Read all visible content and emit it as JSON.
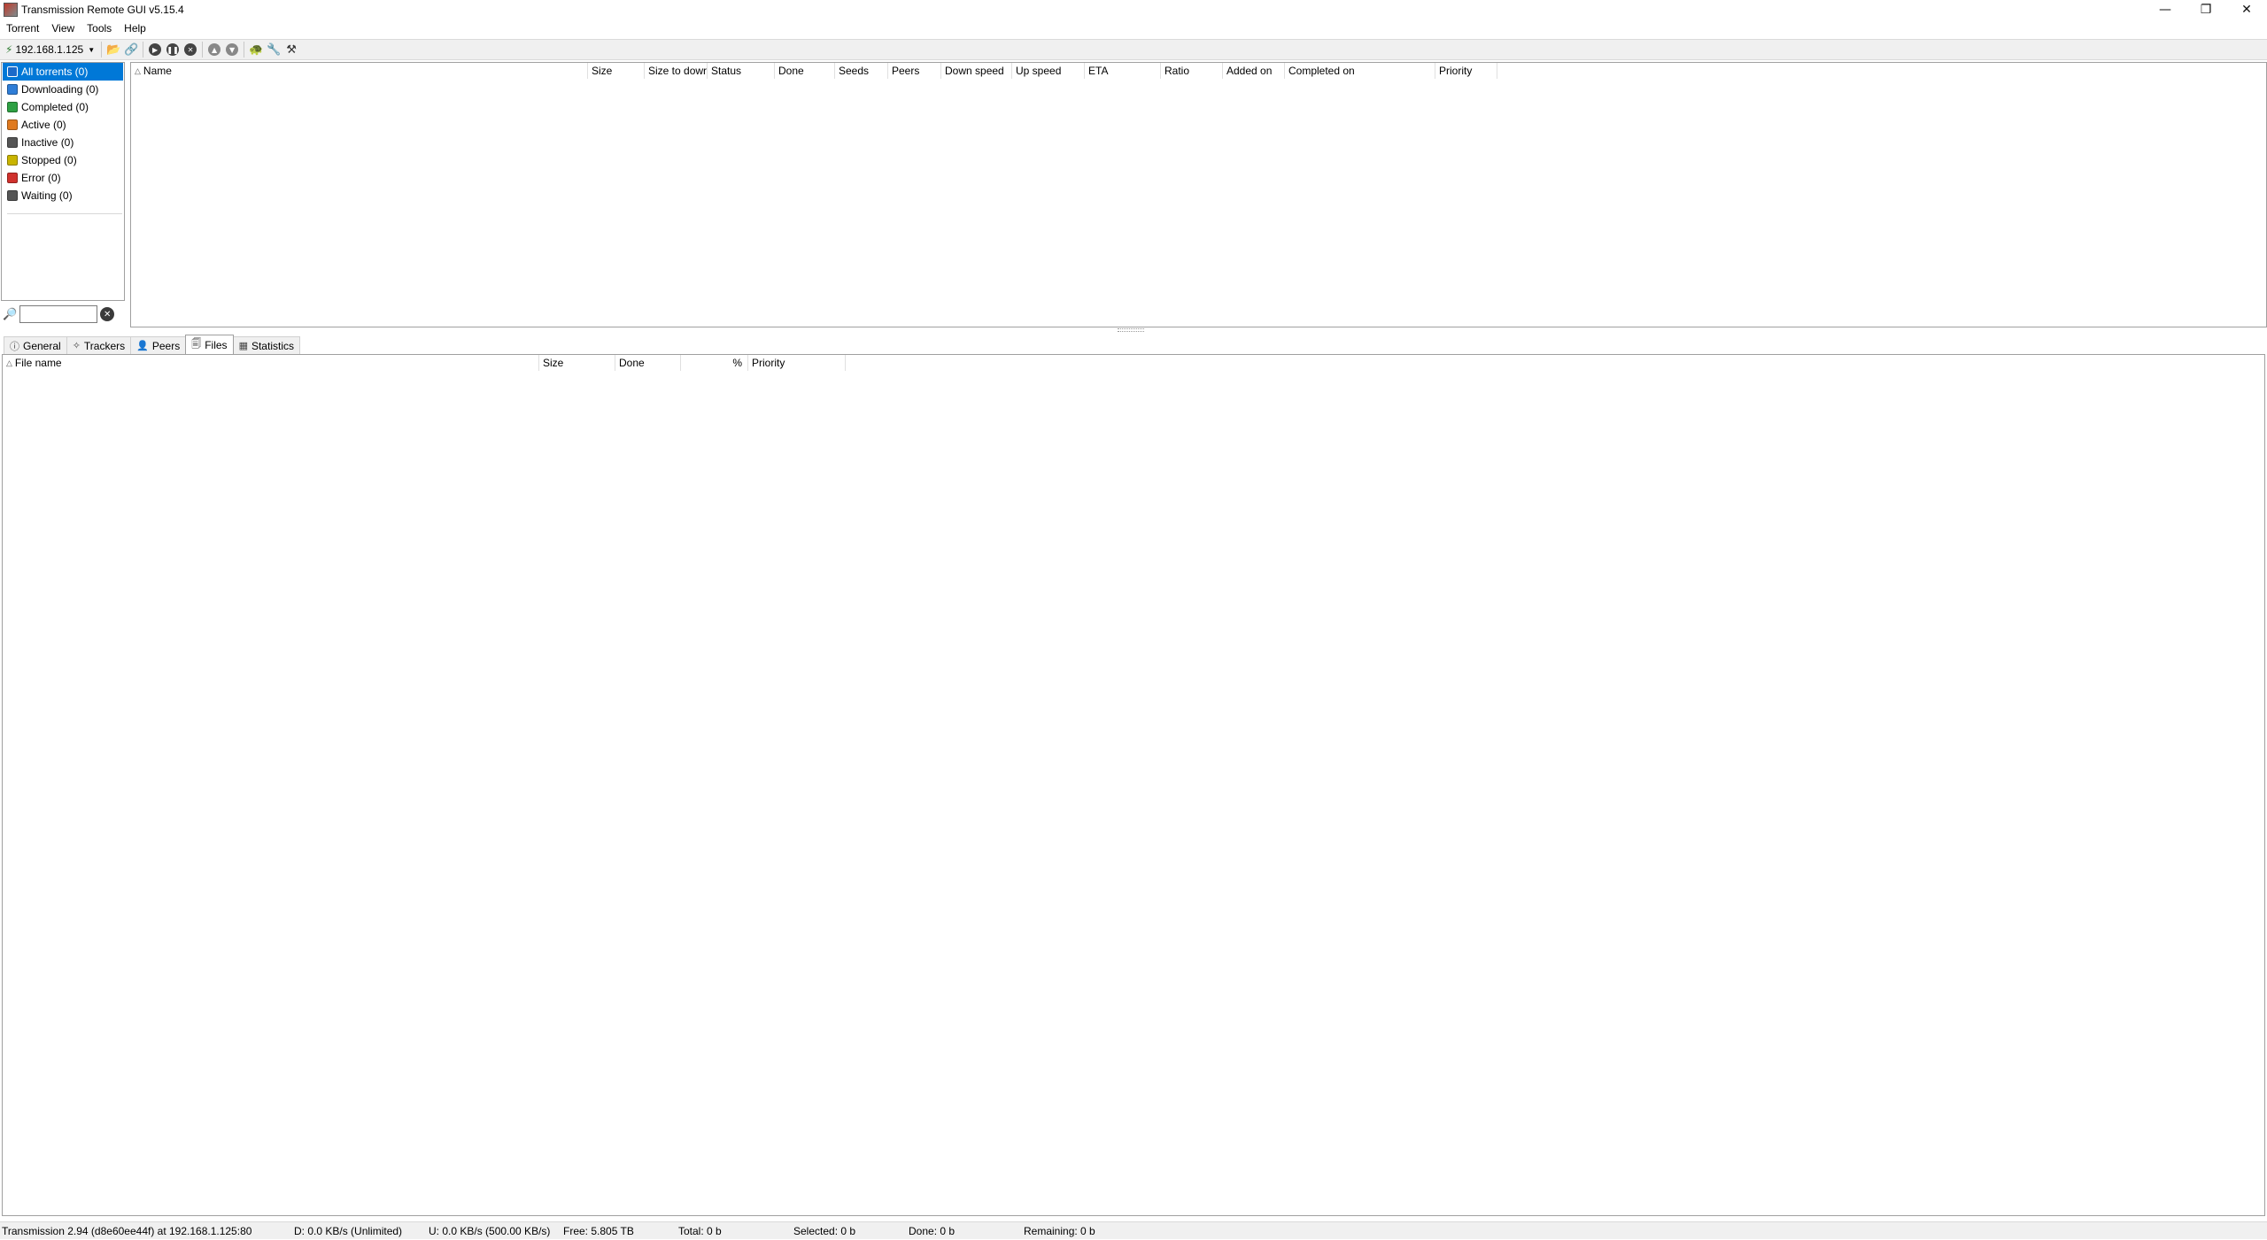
{
  "window": {
    "title": "Transmission Remote GUI v5.15.4",
    "controls": {
      "minimize": "—",
      "restore": "❐",
      "close": "✕"
    }
  },
  "menu": [
    "Torrent",
    "View",
    "Tools",
    "Help"
  ],
  "toolbar": {
    "host": "192.168.1.125",
    "buttons": [
      {
        "name": "add-torrent",
        "icon": "folder-open-icon"
      },
      {
        "name": "add-link",
        "icon": "link-icon"
      },
      {
        "name": "start-all",
        "icon": "play-icon"
      },
      {
        "name": "pause-all",
        "icon": "pause-icon"
      },
      {
        "name": "remove",
        "icon": "stop-icon"
      },
      {
        "name": "move-up",
        "icon": "up-icon"
      },
      {
        "name": "move-down",
        "icon": "down-icon"
      },
      {
        "name": "turtle",
        "icon": "turtle-icon"
      },
      {
        "name": "options",
        "icon": "wrench-icon"
      },
      {
        "name": "settings",
        "icon": "tools-icon"
      }
    ]
  },
  "filters": [
    {
      "label": "All torrents (0)",
      "color": "#1b6ac9",
      "selected": true
    },
    {
      "label": "Downloading (0)",
      "color": "#2e7dd7"
    },
    {
      "label": "Completed (0)",
      "color": "#2ea043"
    },
    {
      "label": "Active (0)",
      "color": "#e07a1f"
    },
    {
      "label": "Inactive (0)",
      "color": "#555555"
    },
    {
      "label": "Stopped (0)",
      "color": "#c9b400"
    },
    {
      "label": "Error (0)",
      "color": "#d0312d"
    },
    {
      "label": "Waiting (0)",
      "color": "#555555"
    }
  ],
  "search": {
    "value": "",
    "placeholder": ""
  },
  "torrent_columns": [
    "Name",
    "Size",
    "Size to dowr",
    "Status",
    "Done",
    "Seeds",
    "Peers",
    "Down speed",
    "Up speed",
    "ETA",
    "Ratio",
    "Added on",
    "Completed on",
    "Priority"
  ],
  "tabs": [
    "General",
    "Trackers",
    "Peers",
    "Files",
    "Statistics"
  ],
  "active_tab": "Files",
  "file_columns": [
    "File name",
    "Size",
    "Done",
    "%",
    "Priority"
  ],
  "status": {
    "server": "Transmission 2.94 (d8e60ee44f) at 192.168.1.125:80",
    "down": "D: 0.0 KB/s (Unlimited)",
    "up": "U: 0.0 KB/s (500.00 KB/s)",
    "free": "Free: 5.805 TB",
    "total": "Total: 0 b",
    "selected": "Selected: 0 b",
    "done": "Done: 0 b",
    "remaining": "Remaining: 0 b"
  }
}
